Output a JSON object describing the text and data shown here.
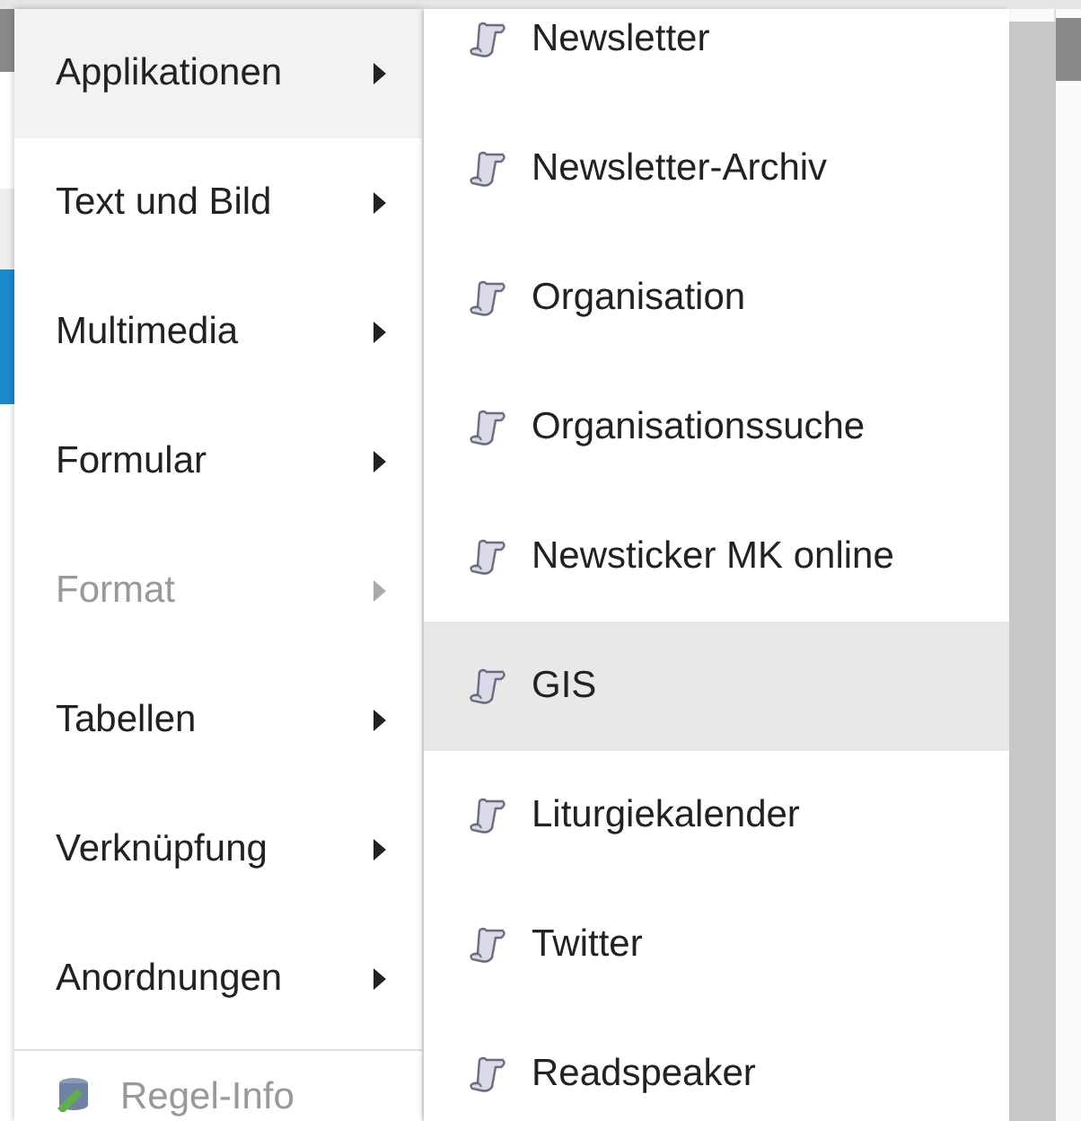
{
  "menu": {
    "items": [
      {
        "label": "Applikationen",
        "selected": true,
        "disabled": false
      },
      {
        "label": "Text und Bild",
        "selected": false,
        "disabled": false
      },
      {
        "label": "Multimedia",
        "selected": false,
        "disabled": false
      },
      {
        "label": "Formular",
        "selected": false,
        "disabled": false
      },
      {
        "label": "Format",
        "selected": false,
        "disabled": true
      },
      {
        "label": "Tabellen",
        "selected": false,
        "disabled": false
      },
      {
        "label": "Verknüpfung",
        "selected": false,
        "disabled": false
      },
      {
        "label": "Anordnungen",
        "selected": false,
        "disabled": false
      }
    ],
    "footer_item": {
      "label": "Regel-Info",
      "disabled": true
    }
  },
  "submenu": {
    "items": [
      {
        "label": "Newsletter",
        "selected": false
      },
      {
        "label": "Newsletter-Archiv",
        "selected": false
      },
      {
        "label": "Organisation",
        "selected": false
      },
      {
        "label": "Organisationssuche",
        "selected": false
      },
      {
        "label": "Newsticker MK online",
        "selected": false
      },
      {
        "label": "GIS",
        "selected": true
      },
      {
        "label": "Liturgiekalender",
        "selected": false
      },
      {
        "label": "Twitter",
        "selected": false
      },
      {
        "label": "Readspeaker",
        "selected": false
      }
    ]
  }
}
